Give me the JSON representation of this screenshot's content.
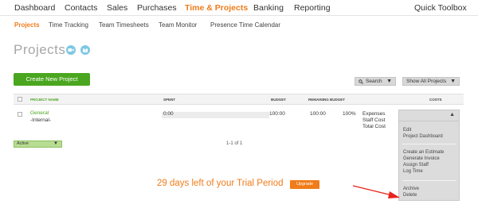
{
  "top_nav": {
    "items": [
      "Dashboard",
      "Contacts",
      "Sales",
      "Purchases",
      "Time & Projects",
      "Banking",
      "Reporting"
    ],
    "active": "Time & Projects",
    "quick_toolbox": "Quick Toolbox"
  },
  "sub_nav": {
    "items": [
      "Projects",
      "Time Tracking",
      "Team Timesheets",
      "Team Monitor",
      "Presence Time Calendar"
    ],
    "active": "Projects"
  },
  "page": {
    "title": "Projects",
    "icons": [
      "video-icon",
      "book-icon"
    ],
    "create_button": "Create New Project"
  },
  "toolbar": {
    "search_label": "Search",
    "filter_label": "Show All Projects"
  },
  "table": {
    "columns": [
      "PROJECT NAME",
      "SPENT",
      "BUDGET",
      "REMAINING BUDGET",
      "COSTS"
    ],
    "rows": [
      {
        "name": "General",
        "subtitle": "-Internal-",
        "spent": "0:00",
        "budget": "100:00",
        "remaining": "100:00",
        "remaining_pct": "100%",
        "cost_labels": [
          "Expenses",
          "Staff Cost",
          "Total Cost"
        ]
      }
    ]
  },
  "status_select": "Active",
  "pager": "1-1 of 1",
  "actions_menu": {
    "groups": [
      [
        "Edit",
        "Project Dashboard"
      ],
      [
        "Create an Estimate",
        "Generate Invoice",
        "Assign Staff",
        "Log Time"
      ],
      [
        "Archive",
        "Delete"
      ]
    ]
  },
  "trial": {
    "message": "29 days left of your Trial Period",
    "upgrade_label": "Upgrade"
  },
  "colors": {
    "accent_orange": "#f07c1a",
    "brand_green": "#4aa61f",
    "annotation_red": "#e8231d"
  }
}
